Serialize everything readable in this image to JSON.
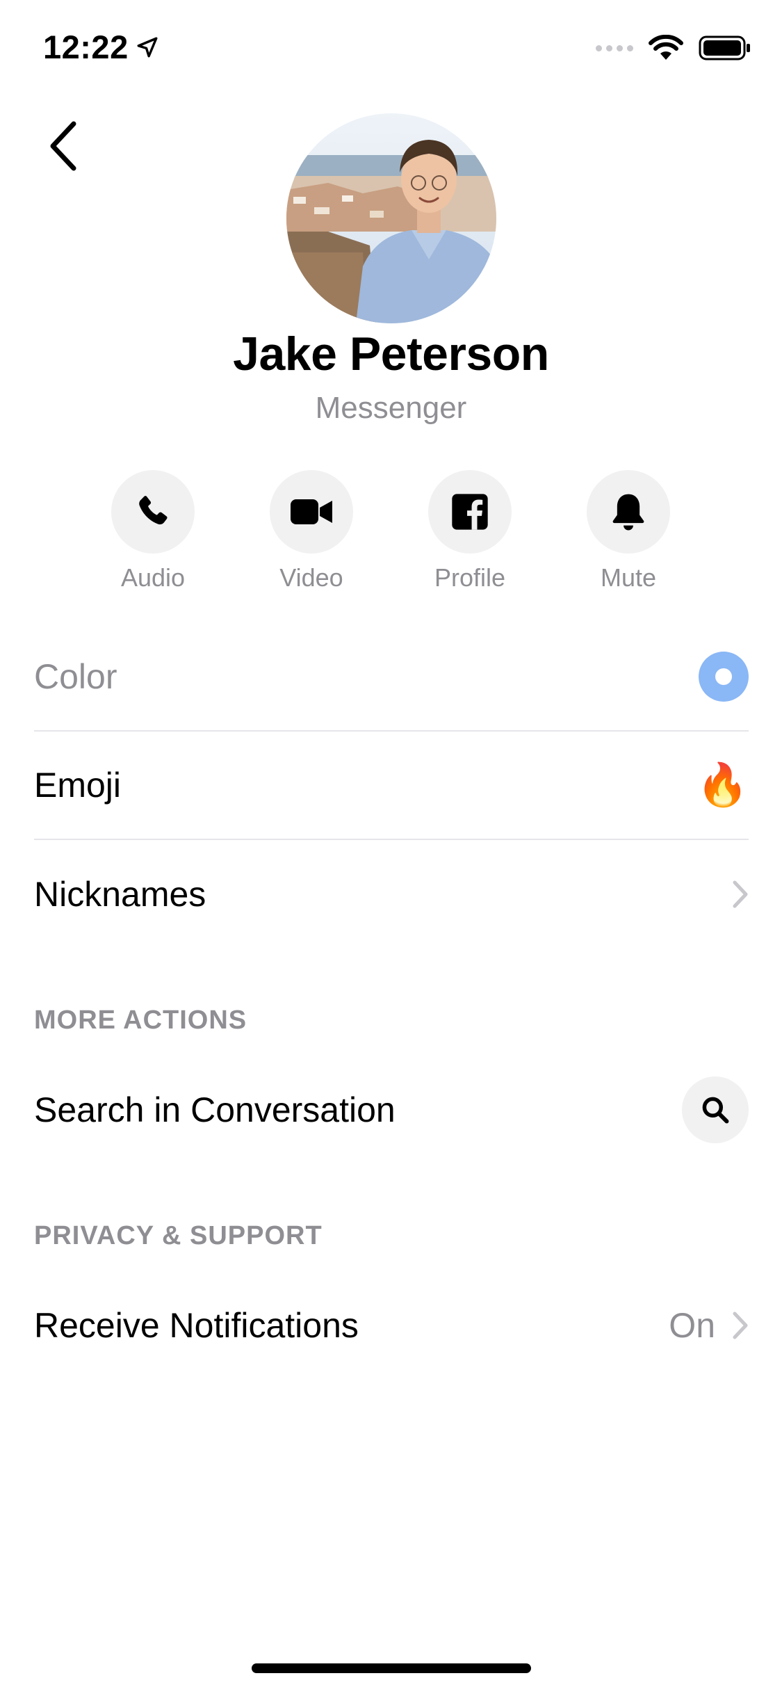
{
  "status_bar": {
    "time": "12:22"
  },
  "profile": {
    "name": "Jake Peterson",
    "subtitle": "Messenger"
  },
  "actions": [
    {
      "label": "Audio",
      "icon": "phone-icon"
    },
    {
      "label": "Video",
      "icon": "video-camera-icon"
    },
    {
      "label": "Profile",
      "icon": "facebook-icon"
    },
    {
      "label": "Mute",
      "icon": "bell-icon"
    }
  ],
  "settings": {
    "color": {
      "label": "Color",
      "swatch": "#8ab7f5"
    },
    "emoji": {
      "label": "Emoji",
      "value": "🔥"
    },
    "nicknames": {
      "label": "Nicknames"
    }
  },
  "more_actions": {
    "header": "MORE ACTIONS",
    "search_label": "Search in Conversation"
  },
  "privacy_support": {
    "header": "PRIVACY & SUPPORT",
    "notifications_label": "Receive Notifications",
    "notifications_value": "On"
  },
  "colors": {
    "secondary_text": "#8e8e93",
    "button_bg": "#f1f1f2",
    "accent": "#8ab7f5"
  }
}
